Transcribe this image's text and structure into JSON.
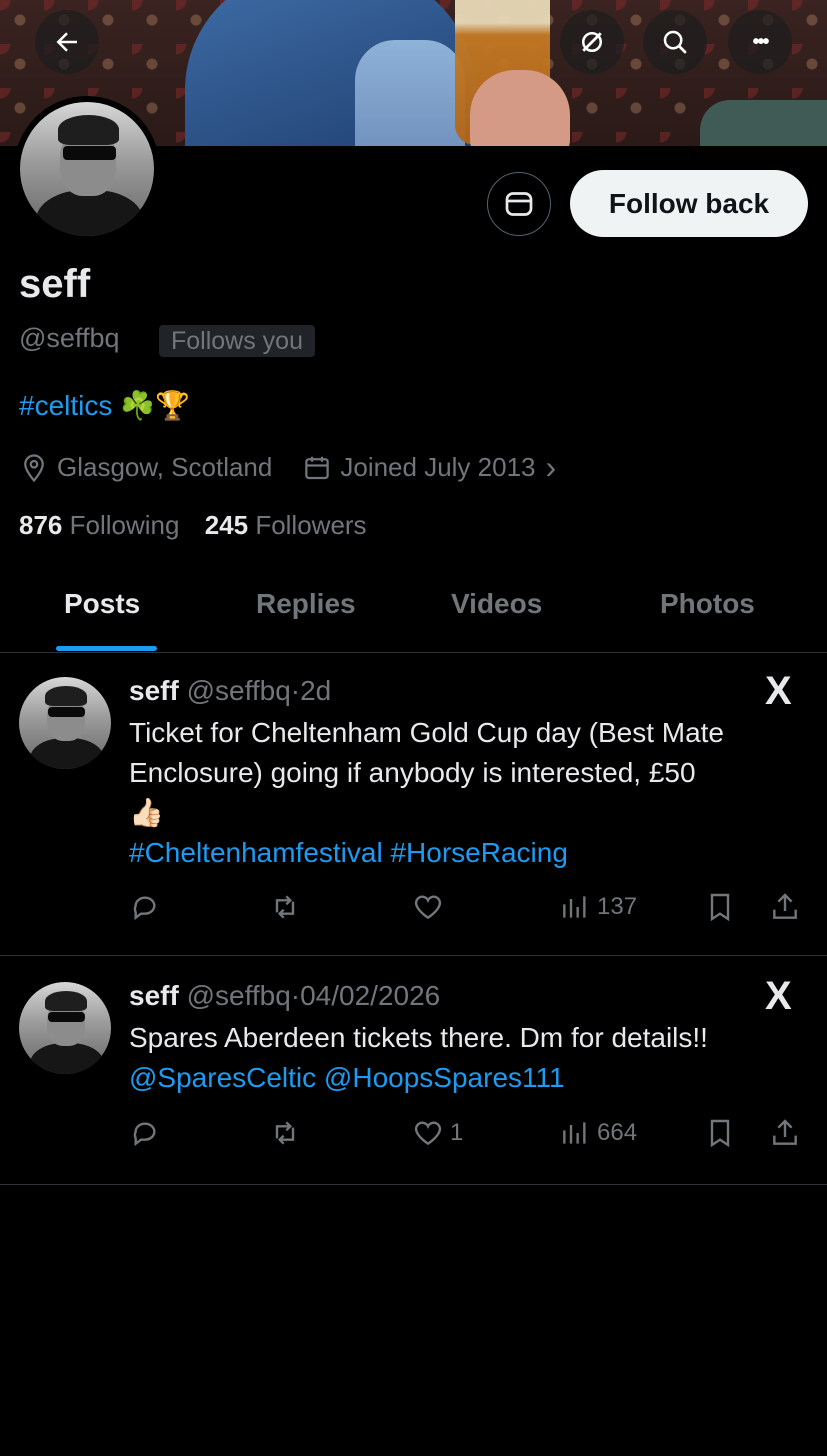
{
  "header": {
    "back_icon": "arrow-left-icon",
    "grok_icon": "grok-slash-icon",
    "search_icon": "search-icon",
    "more_icon": "more-dots-icon",
    "more_glyph": "•••"
  },
  "profile": {
    "name": "seff",
    "handle": "@seffbq",
    "follows_you": "Follows you",
    "bio_tag": "#celtics",
    "bio_emoji": "☘️🏆",
    "location": "Glasgow, Scotland",
    "joined": "Joined July 2013",
    "joined_chevron": "›",
    "following_count": "876",
    "following_label": "Following",
    "followers_count": "245",
    "followers_label": "Followers",
    "follow_back_label": "Follow back",
    "message_icon": "envelope-icon"
  },
  "tabs": [
    {
      "label": "Posts",
      "active": true
    },
    {
      "label": "Replies"
    },
    {
      "label": "Videos"
    },
    {
      "label": "Photos"
    }
  ],
  "posts": [
    {
      "name": "seff",
      "handle": "@seffbq",
      "sep": "·",
      "time": "2d",
      "source_logo": "X",
      "text": "Ticket for Cheltenham Gold Cup day (Best Mate Enclosure) going if anybody is interested, £50",
      "emoji": "👍🏻",
      "tags": "#Cheltenhamfestival #HorseRacing",
      "likes": "",
      "views": "137"
    },
    {
      "name": "seff",
      "handle": "@seffbq",
      "sep": "·",
      "time": "04/02/2026",
      "source_logo": "X",
      "text": "Spares Aberdeen tickets there. Dm for details!!",
      "tags": "@SparesCeltic @HoopsSpares111",
      "likes": "1",
      "views": "664"
    }
  ],
  "colors": {
    "background": "#000000",
    "accent": "#1d9bf0",
    "text_primary": "#e7e9ea",
    "text_secondary": "#71767b",
    "divider": "#2f3336",
    "button_light": "#eff3f4"
  }
}
